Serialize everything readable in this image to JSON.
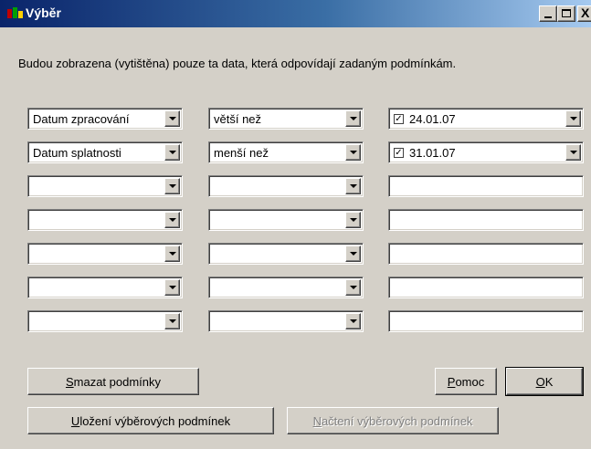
{
  "window": {
    "title": "Výběr",
    "icon": "app-icon",
    "controls": {
      "minimize": "_",
      "maximize": "□",
      "close": "X"
    }
  },
  "info_text": "Budou zobrazena (vytištěna) pouze ta data, která odpovídají zadaným podmínkám.",
  "conditions": [
    {
      "field": "Datum zpracování",
      "operator": "větší než",
      "checked": true,
      "value": "24.01.07"
    },
    {
      "field": "Datum splatnosti",
      "operator": "menší než",
      "checked": true,
      "value": "31.01.07"
    },
    {
      "field": "",
      "operator": "",
      "checked": false,
      "value": ""
    },
    {
      "field": "",
      "operator": "",
      "checked": false,
      "value": ""
    },
    {
      "field": "",
      "operator": "",
      "checked": false,
      "value": ""
    },
    {
      "field": "",
      "operator": "",
      "checked": false,
      "value": ""
    },
    {
      "field": "",
      "operator": "",
      "checked": false,
      "value": ""
    }
  ],
  "buttons": {
    "clear": {
      "mnemonic": "S",
      "rest": "mazat podmínky"
    },
    "help": {
      "mnemonic": "P",
      "rest": "omoc"
    },
    "ok": {
      "mnemonic": "O",
      "rest": "K"
    },
    "save": {
      "mnemonic": "U",
      "rest": "ložení výběrových podmínek"
    },
    "load": {
      "mnemonic": "N",
      "rest": "ačtení výběrových podmínek",
      "enabled": false
    }
  },
  "colors": {
    "face": "#d4d0c8",
    "title_start": "#0a246a",
    "title_end": "#a6caf0"
  }
}
